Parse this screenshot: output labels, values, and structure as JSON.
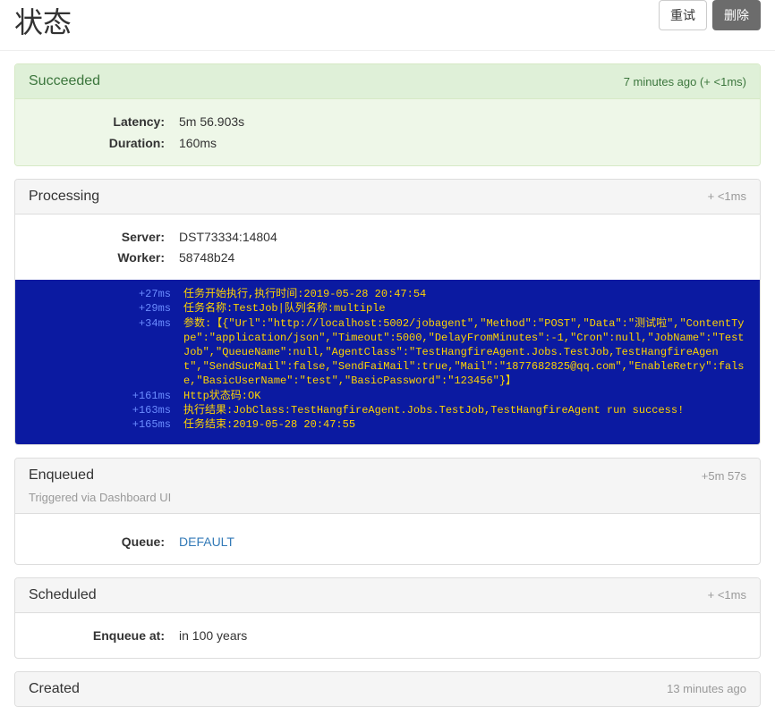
{
  "header": {
    "title": "状态",
    "retry_label": "重试",
    "delete_label": "删除"
  },
  "succeeded": {
    "title": "Succeeded",
    "ago": "7 minutes ago (+ <1ms)",
    "latency_label": "Latency:",
    "latency_value": "5m 56.903s",
    "duration_label": "Duration:",
    "duration_value": "160ms"
  },
  "processing": {
    "title": "Processing",
    "ago": "+ <1ms",
    "server_label": "Server:",
    "server_value": "DST73334:14804",
    "worker_label": "Worker:",
    "worker_value": "58748b24",
    "console": [
      {
        "ts": "+27ms",
        "msg": "任务开始执行,执行时间:2019-05-28 20:47:54"
      },
      {
        "ts": "+29ms",
        "msg": "任务名称:TestJob|队列名称:multiple"
      },
      {
        "ts": "+34ms",
        "msg": "参数:【{\"Url\":\"http://localhost:5002/jobagent\",\"Method\":\"POST\",\"Data\":\"测试啦\",\"ContentType\":\"application/json\",\"Timeout\":5000,\"DelayFromMinutes\":-1,\"Cron\":null,\"JobName\":\"TestJob\",\"QueueName\":null,\"AgentClass\":\"TestHangfireAgent.Jobs.TestJob,TestHangfireAgent\",\"SendSucMail\":false,\"SendFaiMail\":true,\"Mail\":\"1877682825@qq.com\",\"EnableRetry\":false,\"BasicUserName\":\"test\",\"BasicPassword\":\"123456\"}】"
      },
      {
        "ts": "+161ms",
        "msg": "Http状态码:OK"
      },
      {
        "ts": "+163ms",
        "msg": "执行结果:JobClass:TestHangfireAgent.Jobs.TestJob,TestHangfireAgent run success!"
      },
      {
        "ts": "+165ms",
        "msg": "任务结束:2019-05-28 20:47:55"
      }
    ]
  },
  "enqueued": {
    "title": "Enqueued",
    "ago": "+5m 57s",
    "sub": "Triggered via Dashboard UI",
    "queue_label": "Queue:",
    "queue_value": "DEFAULT"
  },
  "scheduled": {
    "title": "Scheduled",
    "ago": "+ <1ms",
    "enqueue_at_label": "Enqueue at:",
    "enqueue_at_value": "in 100 years"
  },
  "created": {
    "title": "Created",
    "ago": "13 minutes ago"
  }
}
